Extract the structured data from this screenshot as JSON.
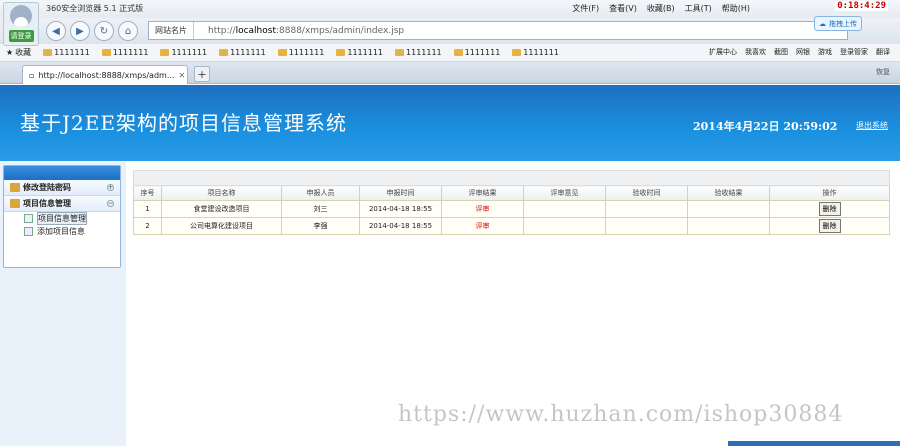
{
  "browser": {
    "title": "360安全浏览器 5.1 正式版",
    "badge": "请登录",
    "menu": [
      "文件(F)",
      "查看(V)",
      "收藏(B)",
      "工具(T)",
      "帮助(H)"
    ],
    "clock": "0:18:4:29",
    "upload": "拖拽上传",
    "net_label": "网站名片",
    "url_prefix": "http://",
    "url_host": "localhost",
    "url_rest": ":8888/xmps/admin/index.jsp",
    "favorites_label": "收藏",
    "favorites": [
      "1111111",
      "1111111",
      "1111111",
      "1111111",
      "1111111",
      "1111111",
      "1111111",
      "1111111",
      "1111111"
    ],
    "fav_right": [
      "扩展中心",
      "我喜欢",
      "截图",
      "网银",
      "游戏",
      "登录管家",
      "翻译"
    ],
    "tab_title": "http://localhost:8888/xmps/adm...",
    "tab_right": [
      "恢复"
    ]
  },
  "header": {
    "title": "基于J2EE架构的项目信息管理系统",
    "datetime": "2014年4月22日  20:59:02",
    "logout": "退出系统"
  },
  "sidebar": {
    "items": [
      {
        "label": "修改登陆密码"
      },
      {
        "label": "项目信息管理"
      }
    ],
    "subitems": [
      "项目信息管理",
      "添加项目信息"
    ]
  },
  "table": {
    "headers": [
      "序号",
      "项目名称",
      "申报人员",
      "申报时间",
      "评审结果",
      "评审意见",
      "验收时间",
      "验收结果",
      "操作"
    ],
    "rows": [
      [
        "1",
        "食堂建设改造项目",
        "刘三",
        "2014-04-18 18:55",
        "评审",
        "",
        "",
        "",
        "删除"
      ],
      [
        "2",
        "公司电算化建设项目",
        "李强",
        "2014-04-18 18:55",
        "评审",
        "",
        "",
        "",
        "删除"
      ]
    ]
  },
  "watermark": "https://www.huzhan.com/ishop30884",
  "colors": {
    "header": "#1a90e0",
    "accent": "#d00000"
  }
}
